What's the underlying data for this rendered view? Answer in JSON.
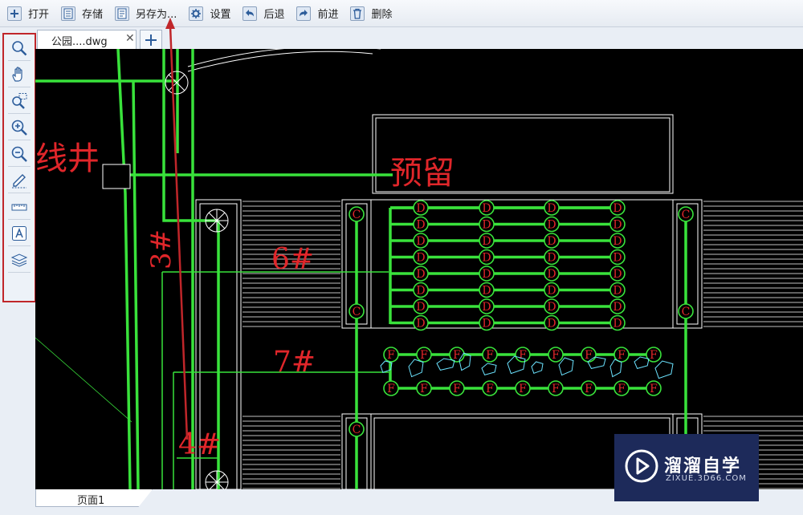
{
  "toolbar": {
    "open": "打开",
    "save": "存储",
    "save_as": "另存为...",
    "settings": "设置",
    "back": "后退",
    "forward": "前进",
    "delete": "删除"
  },
  "tabs": {
    "document": "公园....dwg"
  },
  "canvas": {
    "labels": {
      "well": "线井",
      "reserved": "预留",
      "n3": "3#",
      "n4": "4#",
      "n6": "6#",
      "n7": "7#",
      "c": "C",
      "d": "D",
      "f": "F"
    }
  },
  "pages": {
    "page1": "页面1"
  },
  "watermark": {
    "title": "溜溜自学",
    "subtitle": "ZIXUE.3D66.COM"
  },
  "colors": {
    "cad_green": "#39e23b",
    "cad_red": "#e0262a",
    "annotation_red": "#c0262a"
  }
}
